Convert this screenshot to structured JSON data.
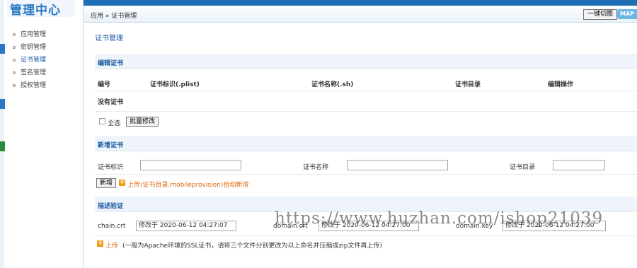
{
  "sidebar": {
    "logo": "管理中心",
    "items": [
      {
        "label": "应用管理"
      },
      {
        "label": "密钥管理"
      },
      {
        "label": "证书管理"
      },
      {
        "label": "签名管理"
      },
      {
        "label": "授权管理"
      }
    ],
    "active_index": 2
  },
  "header": {
    "breadcrumb": "应用 » 证书管理",
    "switch_label": "一键切图",
    "map_label": "MAP ◂"
  },
  "main": {
    "title": "证书管理",
    "edit_section": {
      "title": "编辑证书",
      "columns": [
        "编号",
        "证书标识(.plist)",
        "证书名称(.sh)",
        "证书目录",
        "编辑操作"
      ],
      "empty_text": "没有证书",
      "select_all_label": "全选",
      "batch_edit_label": "批量修改"
    },
    "new_section": {
      "title": "新增证书",
      "id_label": "证书标识",
      "name_label": "证书名称",
      "dir_label": "证书目录",
      "add_label": "新增",
      "upload_text": "上传(证书目录.mobileprovision)自动新增"
    },
    "verify_section": {
      "title": "描述验证",
      "chain_label": "chain.crt",
      "chain_value": "修改于 2020-06-12 04:27:07",
      "domain_label": "domain.crt",
      "domain_value": "修改于 2020-06-12 04:27:00",
      "key_label": "domain.key",
      "key_value": "修改于 2020-06-12 04:27:00",
      "upload_label": "上传",
      "upload_hint": "(一般为Apache环境的SSL证书，请将三个文件分别更改为以上命名并压缩成zip文件再上传)"
    }
  },
  "watermark": "https://www.huzhan.com/ishop21039",
  "colors": {
    "accent": "#1a5aa0",
    "topbar": "#1f6fb5",
    "upload": "#e0680c"
  }
}
